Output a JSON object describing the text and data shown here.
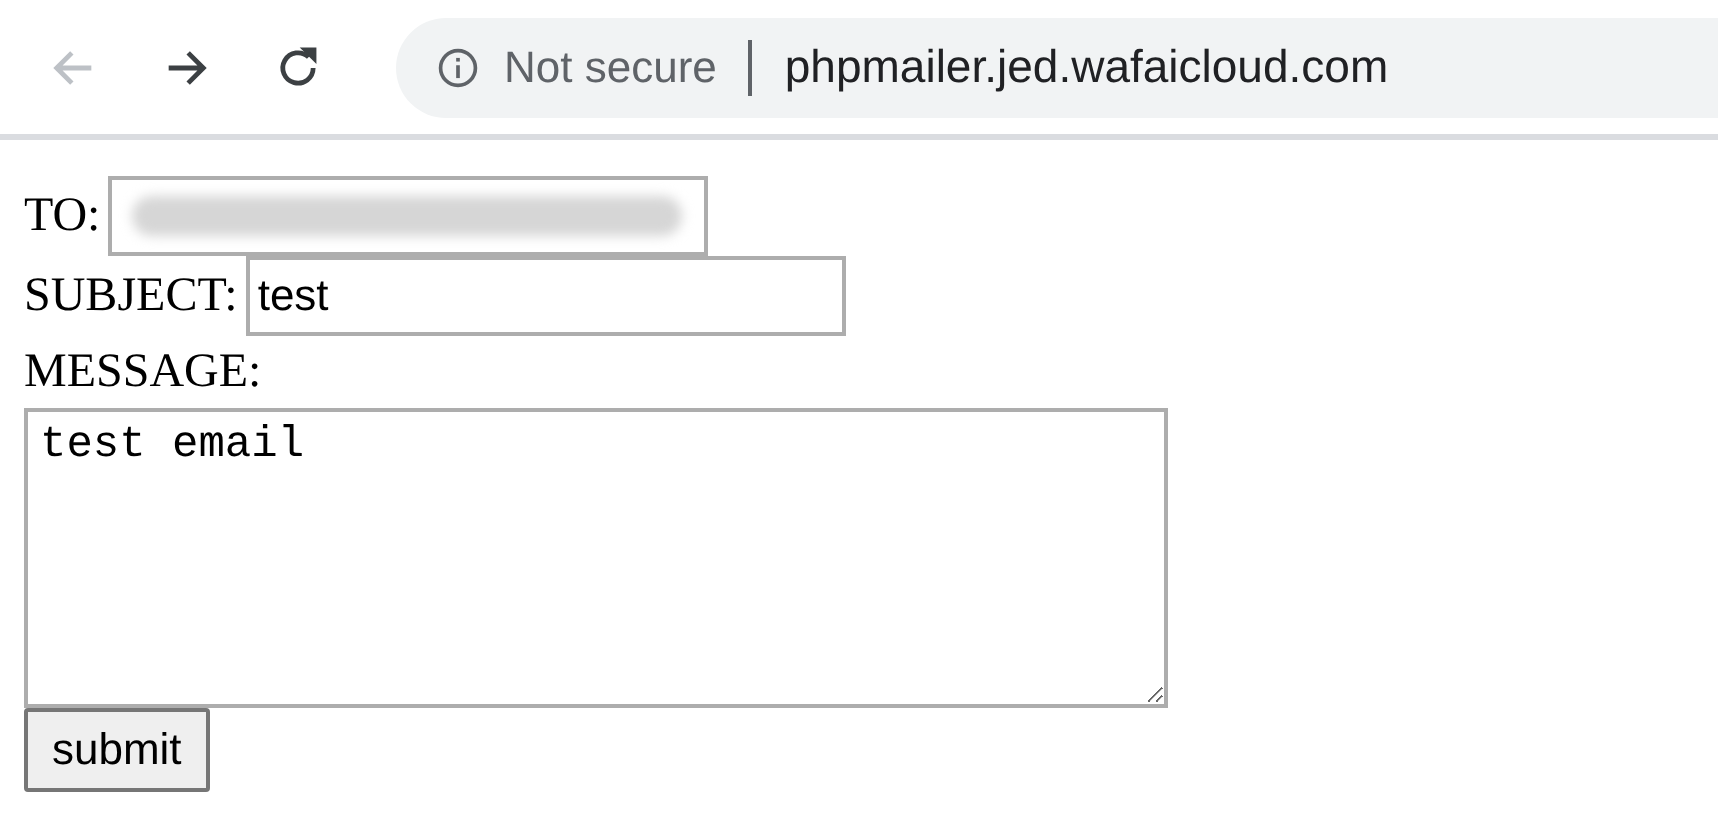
{
  "toolbar": {
    "nav": [
      {
        "kind": "back",
        "disabled": true
      },
      {
        "kind": "forward",
        "disabled": false
      },
      {
        "kind": "reload",
        "disabled": false
      }
    ],
    "address": {
      "security": "Not secure",
      "url": "phpmailer.jed.wafaicloud.com"
    }
  },
  "form": {
    "fields": [
      {
        "kind": "text",
        "label": "TO:",
        "blurred": true
      },
      {
        "kind": "text",
        "label": "SUBJECT:",
        "value": "test",
        "blurred": false
      },
      {
        "kind": "textarea",
        "label": "MESSAGE:",
        "value": "test email",
        "blurred": false
      }
    ],
    "submit": "submit"
  }
}
